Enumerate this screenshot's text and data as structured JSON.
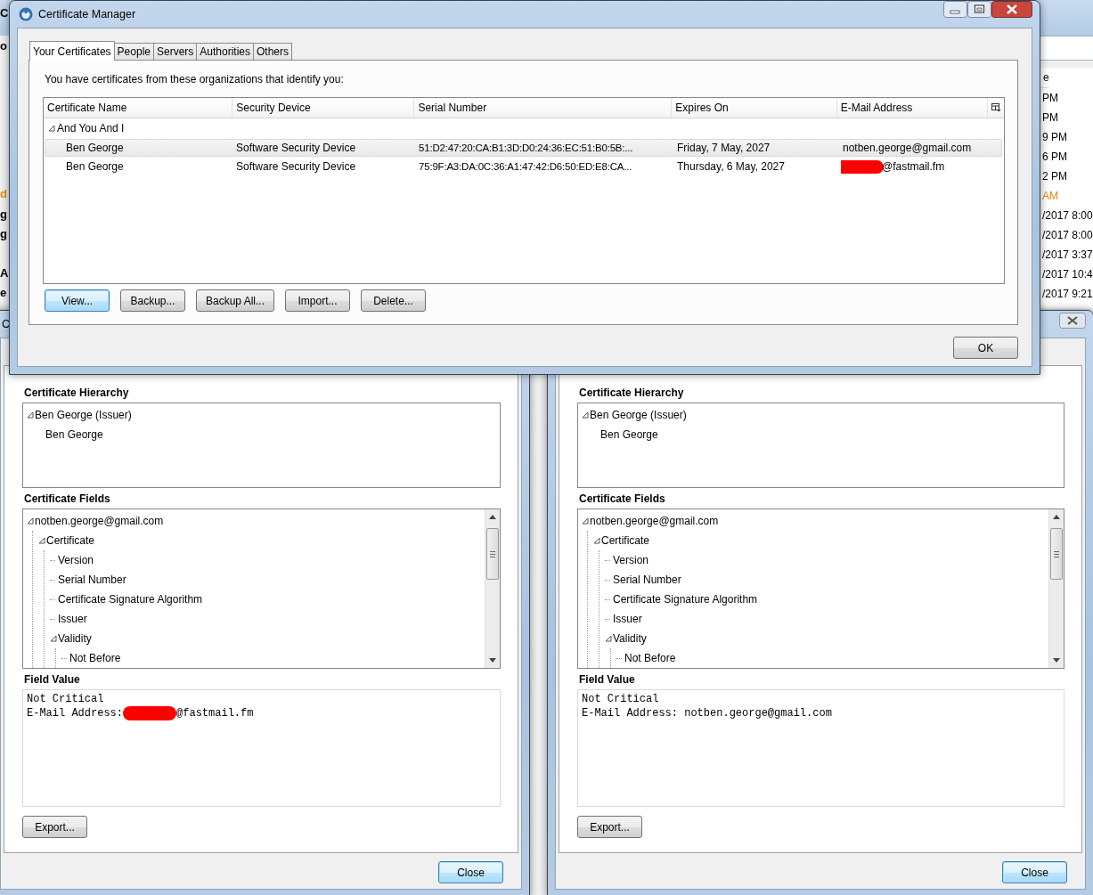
{
  "background_window": {
    "left_fragments": [
      {
        "text": "C",
        "color": "#000000"
      },
      {
        "text": "o",
        "color": "#000000"
      },
      {
        "text": "d",
        "color": "#e8890c"
      },
      {
        "text": "g",
        "color": "#000000"
      },
      {
        "text": "g",
        "color": "#000000"
      },
      {
        "text": "A",
        "color": "#000000"
      },
      {
        "text": "e",
        "color": "#000000"
      }
    ],
    "list_header": "e",
    "list_rows": [
      {
        "text": "PM",
        "color": "#000000"
      },
      {
        "text": "PM",
        "color": "#000000"
      },
      {
        "text": "9 PM",
        "color": "#000000"
      },
      {
        "text": "6 PM",
        "color": "#000000"
      },
      {
        "text": "2 PM",
        "color": "#000000"
      },
      {
        "text": "AM",
        "color": "#e8890c"
      },
      {
        "text": "/2017 8:00",
        "color": "#000000"
      },
      {
        "text": "/2017 8:00",
        "color": "#000000"
      },
      {
        "text": "/2017 3:37",
        "color": "#000000"
      },
      {
        "text": "/2017 10:4",
        "color": "#000000"
      },
      {
        "text": "/2017 9:21",
        "color": "#000000"
      }
    ]
  },
  "viewer_dialogs": [
    {
      "title": "C",
      "hierarchy_label": "Certificate Hierarchy",
      "hierarchy": [
        {
          "label": "Ben George (Issuer)",
          "expanded": true,
          "children": [
            {
              "label": "Ben George"
            }
          ]
        }
      ],
      "fields_label": "Certificate Fields",
      "fields": [
        {
          "label": "notben.george@gmail.com",
          "expanded": true,
          "children": [
            {
              "label": "Certificate",
              "expanded": true,
              "children": [
                {
                  "label": "Version"
                },
                {
                  "label": "Serial Number"
                },
                {
                  "label": "Certificate Signature Algorithm"
                },
                {
                  "label": "Issuer"
                },
                {
                  "label": "Validity",
                  "expanded": true,
                  "children": [
                    {
                      "label": "Not Before"
                    }
                  ]
                }
              ]
            }
          ]
        }
      ],
      "value_label": "Field Value",
      "value_lines": [
        {
          "segments": [
            {
              "kind": "text",
              "text": "Not Critical"
            }
          ]
        },
        {
          "segments": [
            {
              "kind": "text",
              "text": "E-Mail Address:"
            },
            {
              "kind": "redaction"
            },
            {
              "kind": "text",
              "text": "@fastmail.fm"
            }
          ]
        }
      ],
      "export_button": {
        "label": "Export...",
        "default": false
      },
      "close_button": {
        "label": "Close",
        "default": true
      }
    },
    {
      "close_icon": true,
      "hierarchy_label": "Certificate Hierarchy",
      "hierarchy": [
        {
          "label": "Ben George (Issuer)",
          "expanded": true,
          "children": [
            {
              "label": "Ben George"
            }
          ]
        }
      ],
      "fields_label": "Certificate Fields",
      "fields": [
        {
          "label": "notben.george@gmail.com",
          "expanded": true,
          "children": [
            {
              "label": "Certificate",
              "expanded": true,
              "children": [
                {
                  "label": "Version"
                },
                {
                  "label": "Serial Number"
                },
                {
                  "label": "Certificate Signature Algorithm"
                },
                {
                  "label": "Issuer"
                },
                {
                  "label": "Validity",
                  "expanded": true,
                  "children": [
                    {
                      "label": "Not Before"
                    }
                  ]
                }
              ]
            }
          ]
        }
      ],
      "value_label": "Field Value",
      "value_lines": [
        {
          "segments": [
            {
              "kind": "text",
              "text": "Not Critical"
            }
          ]
        },
        {
          "segments": [
            {
              "kind": "text",
              "text": "E-Mail Address: notben.george@gmail.com"
            }
          ]
        }
      ],
      "export_button": {
        "label": "Export...",
        "default": false
      },
      "close_button": {
        "label": "Close",
        "default": true
      }
    }
  ],
  "certificate_manager": {
    "title": "Certificate Manager",
    "tabs": [
      {
        "label": "Your Certificates",
        "selected": true
      },
      {
        "label": "People",
        "selected": false
      },
      {
        "label": "Servers",
        "selected": false
      },
      {
        "label": "Authorities",
        "selected": false
      },
      {
        "label": "Others",
        "selected": false
      }
    ],
    "description": "You have certificates from these organizations that identify you:",
    "columns": [
      "Certificate Name",
      "Security Device",
      "Serial Number",
      "Expires On",
      "E-Mail Address"
    ],
    "groups": [
      {
        "name": "And You And I",
        "expanded": true,
        "rows": [
          {
            "name": "Ben George",
            "device": "Software Security Device",
            "serial": "51:D2:47:20:CA:B1:3D:D0:24:36:EC:51:B0:5B:...",
            "expires": "Friday, 7 May, 2027",
            "email": {
              "text": "notben.george@gmail.com",
              "redacted": false
            },
            "selected": true
          },
          {
            "name": "Ben George",
            "device": "Software Security Device",
            "serial": "75:9F:A3:DA:0C:36:A1:47:42:D6:50:ED:E8:CA...",
            "expires": "Thursday, 6 May, 2027",
            "email": {
              "text": "@fastmail.fm",
              "redacted": true
            },
            "selected": false
          }
        ]
      }
    ],
    "buttons": [
      {
        "label": "View...",
        "default": true
      },
      {
        "label": "Backup...",
        "default": false
      },
      {
        "label": "Backup All...",
        "default": false
      },
      {
        "label": "Import...",
        "default": false
      },
      {
        "label": "Delete...",
        "default": false
      }
    ],
    "ok_button": {
      "label": "OK",
      "default": false
    }
  }
}
